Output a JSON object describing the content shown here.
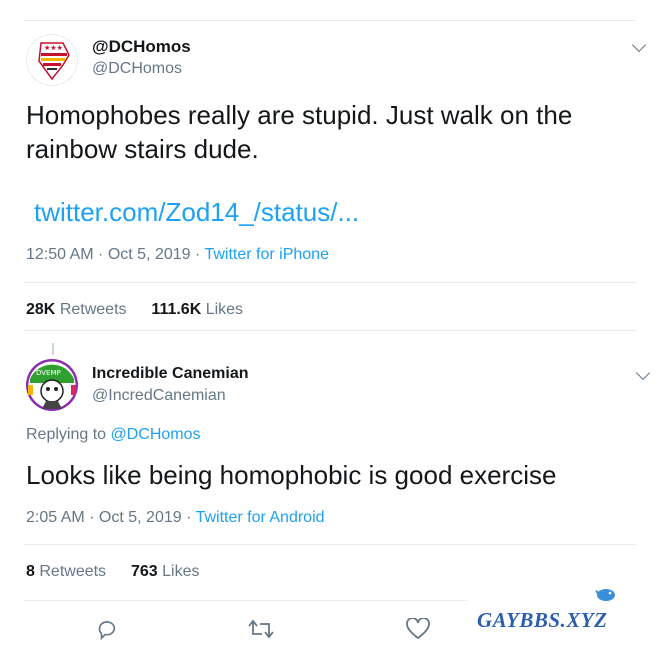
{
  "colors": {
    "link": "#1da1f2",
    "muted": "#657786",
    "text": "#14171a",
    "divider": "#e6ecf0"
  },
  "tweet": {
    "display_name": "@DCHomos",
    "handle": "@DCHomos",
    "text": "Homophobes really are stupid. Just walk on the rainbow stairs dude.",
    "link": "twitter.com/Zod14_/status/...",
    "time": "12:50 AM · Oct 5, 2019 · ",
    "source": "Twitter for iPhone",
    "stats": {
      "retweets_count": "28K",
      "retweets_label": "Retweets",
      "likes_count": "111.6K",
      "likes_label": "Likes"
    }
  },
  "reply": {
    "display_name": "Incredible Canemian",
    "handle": "@IncredCanemian",
    "replying_prefix": "Replying to ",
    "replying_to": "@DCHomos",
    "text": "Looks like being homophobic is good exercise",
    "time": "2:05 AM · Oct 5, 2019 · ",
    "source": "Twitter for Android",
    "stats": {
      "retweets_count": "8",
      "retweets_label": "Retweets",
      "likes_count": "763",
      "likes_label": "Likes"
    },
    "actions": [
      "reply-icon",
      "retweet-icon",
      "like-icon"
    ]
  },
  "watermark": {
    "text": "GAYBBS.XYZ",
    "icon": "bird-icon"
  }
}
